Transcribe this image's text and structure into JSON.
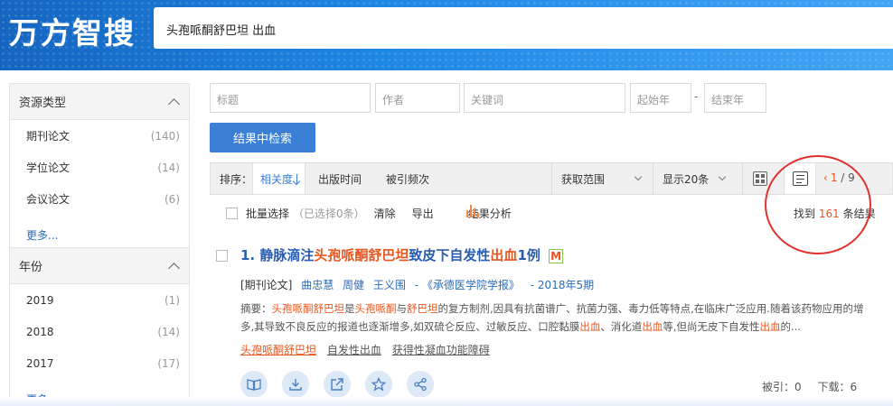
{
  "header": {
    "logo": "万方智搜",
    "query": "头孢哌酮舒巴坦 出血"
  },
  "sidebar": {
    "resource_title": "资源类型",
    "resource_items": [
      {
        "label": "期刊论文",
        "count": "(140)"
      },
      {
        "label": "学位论文",
        "count": "(14)"
      },
      {
        "label": "会议论文",
        "count": "(6)"
      }
    ],
    "more": "更多...",
    "year_title": "年份",
    "year_items": [
      {
        "label": "2019",
        "count": "(1)"
      },
      {
        "label": "2018",
        "count": "(14)"
      },
      {
        "label": "2017",
        "count": "(17)"
      }
    ]
  },
  "filters": {
    "title_ph": "标题",
    "author_ph": "作者",
    "keyword_ph": "关键词",
    "start_year_ph": "起始年",
    "dash": "-",
    "end_year_ph": "结束年",
    "search_btn": "结果中检索"
  },
  "sortbar": {
    "label": "排序：",
    "relevance": "相关度",
    "pub_time": "出版时间",
    "citations": "被引频次",
    "scope": "获取范围",
    "page_size": "显示20条",
    "page_current": "1",
    "page_sep": "/",
    "page_total": "9"
  },
  "actions": {
    "batch_select": "批量选择",
    "selected": "（已选择0条）",
    "clear": "清除",
    "export": "导出",
    "analysis": "结果分析",
    "found_prefix": "找到",
    "found_count": "161",
    "found_suffix": "条结果"
  },
  "result": {
    "index": "1.",
    "title_a": "静脉滴注",
    "title_hl1": "头孢哌酮舒巴坦",
    "title_b": "致皮下自发性",
    "title_hl2": "出血",
    "title_c": "1例",
    "badge": "M",
    "type": "[期刊论文]",
    "authors": [
      "曲忠慧",
      "周健",
      "王义围"
    ],
    "journal": "《承德医学院学报》",
    "date": "2018年5期",
    "abstract_label": "摘要：",
    "abstract_parts": [
      {
        "t": "头孢哌酮舒巴坦",
        "hl": true
      },
      {
        "t": "是",
        "hl": false
      },
      {
        "t": "头孢哌酮",
        "hl": true
      },
      {
        "t": "与",
        "hl": false
      },
      {
        "t": "舒巴坦",
        "hl": true
      },
      {
        "t": "的复方制剂,因具有抗菌谱广、抗菌力强、毒力低等特点,在临床广泛应用.随着该药物应用的增多,其导致不良反应的报道也逐渐增多,如双硫仑反应、过敏反应、口腔黏膜",
        "hl": false
      },
      {
        "t": "出血",
        "hl": true
      },
      {
        "t": "、消化道",
        "hl": false
      },
      {
        "t": "出血",
        "hl": true
      },
      {
        "t": "等,但尚无皮下自发性",
        "hl": false
      },
      {
        "t": "出血",
        "hl": true
      },
      {
        "t": "的...",
        "hl": false
      }
    ],
    "keywords": [
      "头孢哌酮舒巴坦",
      "自发性出血",
      "获得性凝血功能障碍"
    ],
    "cited": "被引：0",
    "downloads": "下载：6"
  },
  "colors": {
    "brand_blue": "#1e88e5",
    "highlight": "#e8561f",
    "annotation": "#e0312f"
  }
}
